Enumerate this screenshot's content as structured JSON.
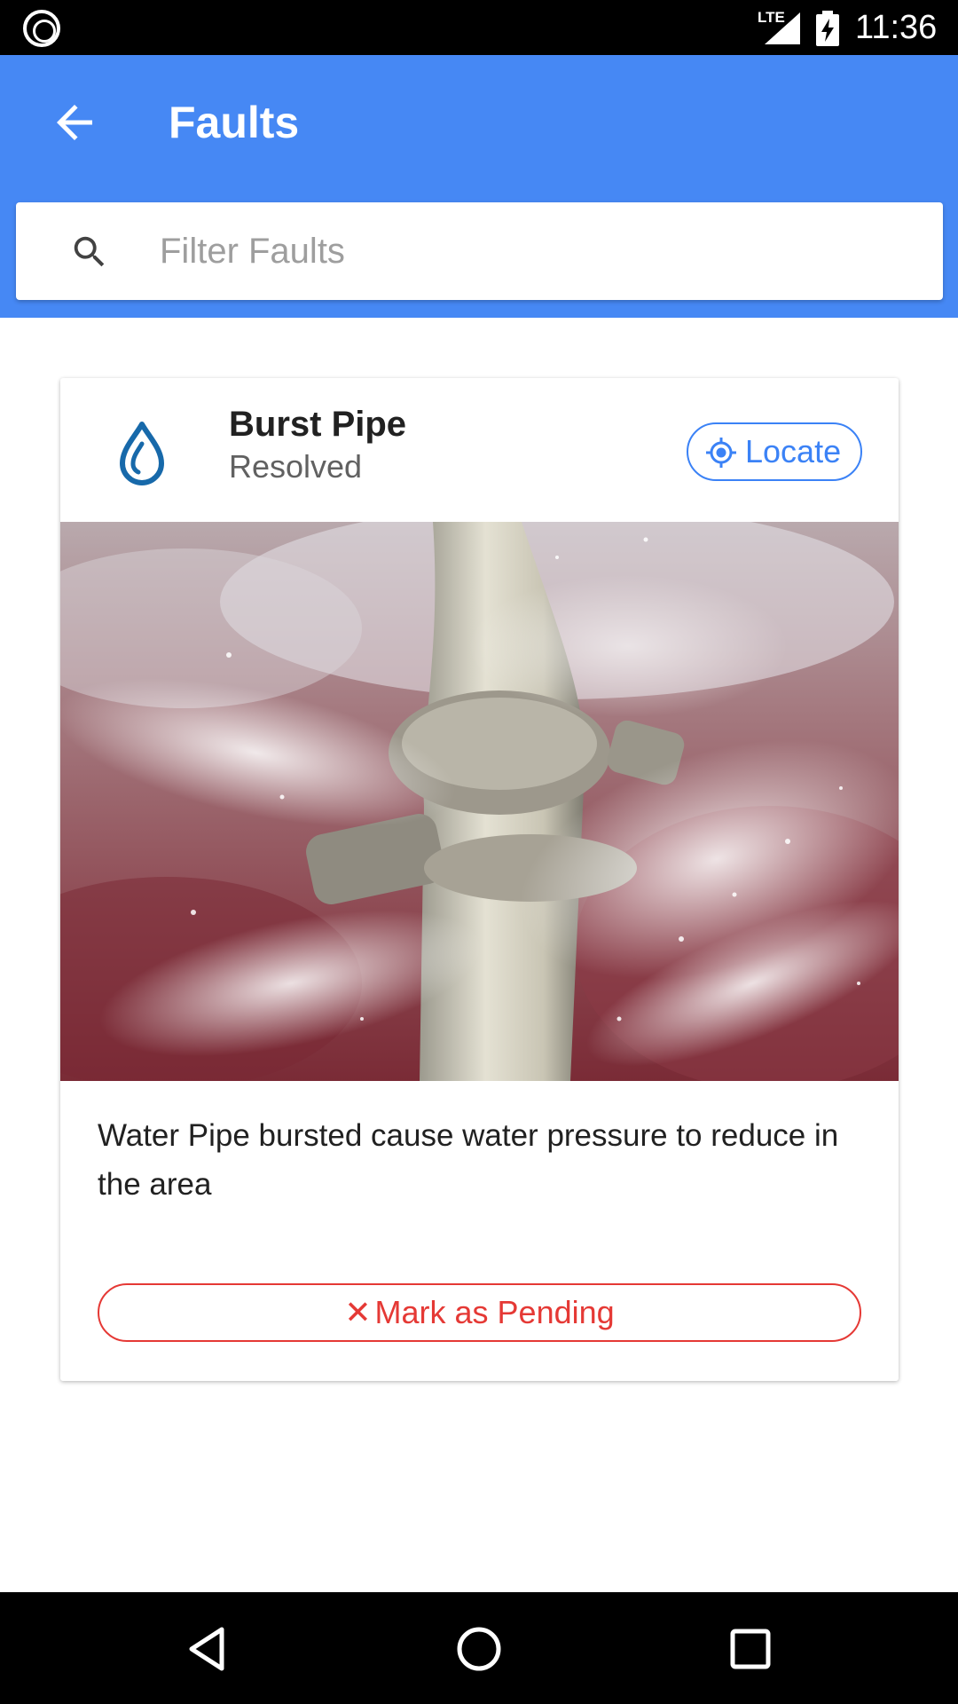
{
  "status_bar": {
    "time": "11:36",
    "network": "LTE",
    "icons": [
      "app-notification-icon",
      "lte-signal-icon",
      "battery-charging-icon"
    ]
  },
  "app_bar": {
    "title": "Faults",
    "back_icon": "arrow-back-icon",
    "background": "#4688f4"
  },
  "search": {
    "placeholder": "Filter Faults",
    "value": "",
    "icon": "search-icon"
  },
  "faults": [
    {
      "title": "Burst Pipe",
      "status": "Resolved",
      "icon": "water-drop-icon",
      "locate_label": "Locate",
      "locate_icon": "gps-target-icon",
      "image": "burst-pipe-photo",
      "description": "Water Pipe bursted cause water pressure to reduce in the area",
      "action_label": "Mark as Pending",
      "action_icon": "close-icon",
      "accent_color": "#3b82f6",
      "action_color": "#e53935"
    }
  ],
  "nav_bar": {
    "icons": [
      "nav-back-icon",
      "nav-home-icon",
      "nav-recents-icon"
    ]
  }
}
